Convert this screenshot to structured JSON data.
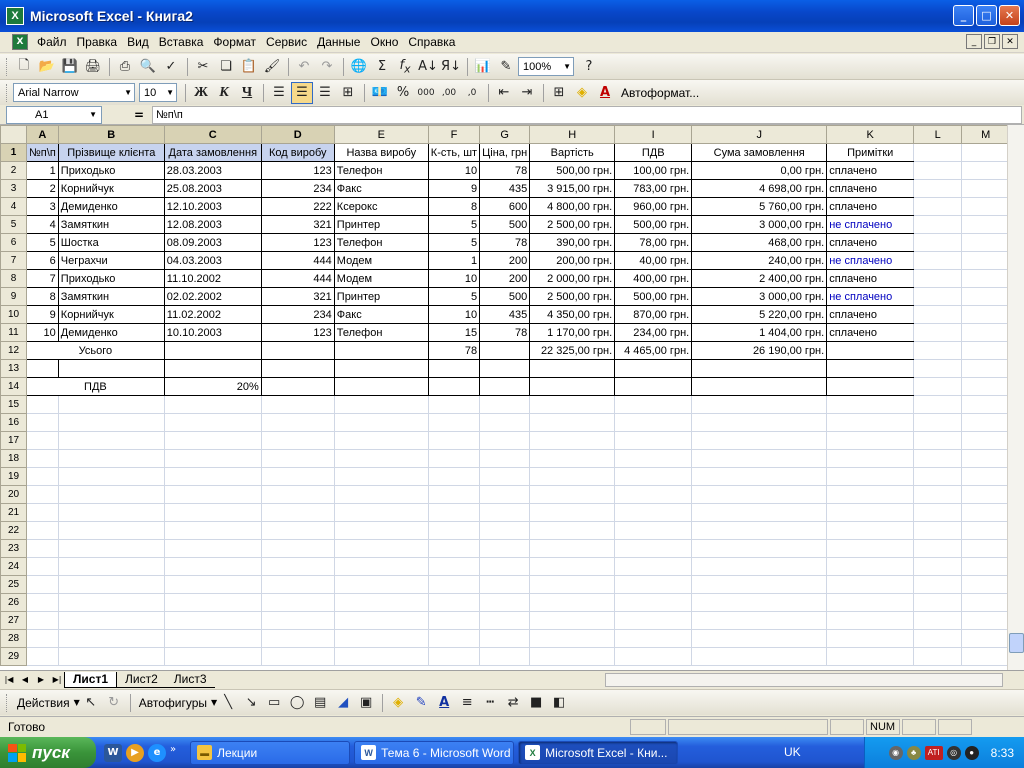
{
  "window": {
    "title": "Microsoft Excel - Книга2",
    "icon": "excel-icon"
  },
  "menu": [
    "Файл",
    "Правка",
    "Вид",
    "Вставка",
    "Формат",
    "Сервис",
    "Данные",
    "Окно",
    "Справка"
  ],
  "toolbar": {
    "zoom": "100%",
    "font_name": "Arial Narrow",
    "font_size": "10",
    "bold": "Ж",
    "italic": "К",
    "underline": "Ч",
    "autoformat": "Автоформат..."
  },
  "formula": {
    "namebox": "A1",
    "eq": "=",
    "content": "№п\\п"
  },
  "grid": {
    "columns": [
      "A",
      "B",
      "C",
      "D",
      "E",
      "F",
      "G",
      "H",
      "I",
      "J",
      "K",
      "L",
      "M"
    ],
    "header": [
      "№п\\п",
      "Прізвище клієнта",
      "Дата замовлення",
      "Код виробу",
      "Назва виробу",
      "К-сть, шт",
      "Ціна, грн",
      "Вартість",
      "ПДВ",
      "Сума замовлення",
      "Примітки"
    ],
    "rows": [
      [
        "1",
        "Приходько",
        "28.03.2003",
        "123",
        "Телефон",
        "10",
        "78",
        "500,00 грн.",
        "100,00 грн.",
        "0,00 грн.",
        "сплачено"
      ],
      [
        "2",
        "Корнийчук",
        "25.08.2003",
        "234",
        "Факс",
        "9",
        "435",
        "3 915,00 грн.",
        "783,00 грн.",
        "4 698,00 грн.",
        "сплачено"
      ],
      [
        "3",
        "Демиденко",
        "12.10.2003",
        "222",
        "Ксерокс",
        "8",
        "600",
        "4 800,00 грн.",
        "960,00 грн.",
        "5 760,00 грн.",
        "сплачено"
      ],
      [
        "4",
        "Замяткин",
        "12.08.2003",
        "321",
        "Принтер",
        "5",
        "500",
        "2 500,00 грн.",
        "500,00 грн.",
        "3 000,00 грн.",
        "не сплачено"
      ],
      [
        "5",
        "Шостка",
        "08.09.2003",
        "123",
        "Телефон",
        "5",
        "78",
        "390,00 грн.",
        "78,00 грн.",
        "468,00 грн.",
        "сплачено"
      ],
      [
        "6",
        "Чеграхчи",
        "04.03.2003",
        "444",
        "Модем",
        "1",
        "200",
        "200,00 грн.",
        "40,00 грн.",
        "240,00 грн.",
        "не сплачено"
      ],
      [
        "7",
        "Приходько",
        "11.10.2002",
        "444",
        "Модем",
        "10",
        "200",
        "2 000,00 грн.",
        "400,00 грн.",
        "2 400,00 грн.",
        "сплачено"
      ],
      [
        "8",
        "Замяткин",
        "02.02.2002",
        "321",
        "Принтер",
        "5",
        "500",
        "2 500,00 грн.",
        "500,00 грн.",
        "3 000,00 грн.",
        "не сплачено"
      ],
      [
        "9",
        "Корнийчук",
        "11.02.2002",
        "234",
        "Факс",
        "10",
        "435",
        "4 350,00 грн.",
        "870,00 грн.",
        "5 220,00 грн.",
        "сплачено"
      ],
      [
        "10",
        "Демиденко",
        "10.10.2003",
        "123",
        "Телефон",
        "15",
        "78",
        "1 170,00 грн.",
        "234,00 грн.",
        "1 404,00 грн.",
        "сплачено"
      ]
    ],
    "totals": {
      "label": "Усього",
      "qty": "78",
      "cost": "22 325,00 грн.",
      "vat": "4 465,00 грн.",
      "sum": "26 190,00 грн."
    },
    "vat_row": {
      "label": "ПДВ",
      "value": "20%"
    },
    "row_count": 29
  },
  "sheets": [
    "Лист1",
    "Лист2",
    "Лист3"
  ],
  "drawbar": {
    "actions": "Действия",
    "autoshapes": "Автофигуры"
  },
  "status": {
    "ready": "Готово",
    "num": "NUM"
  },
  "taskbar": {
    "start": "пуск",
    "buttons": [
      "Лекции",
      "Тема 6 - Microsoft Word",
      "Microsoft Excel - Кни..."
    ],
    "lang": "UK",
    "clock": "8:33"
  }
}
